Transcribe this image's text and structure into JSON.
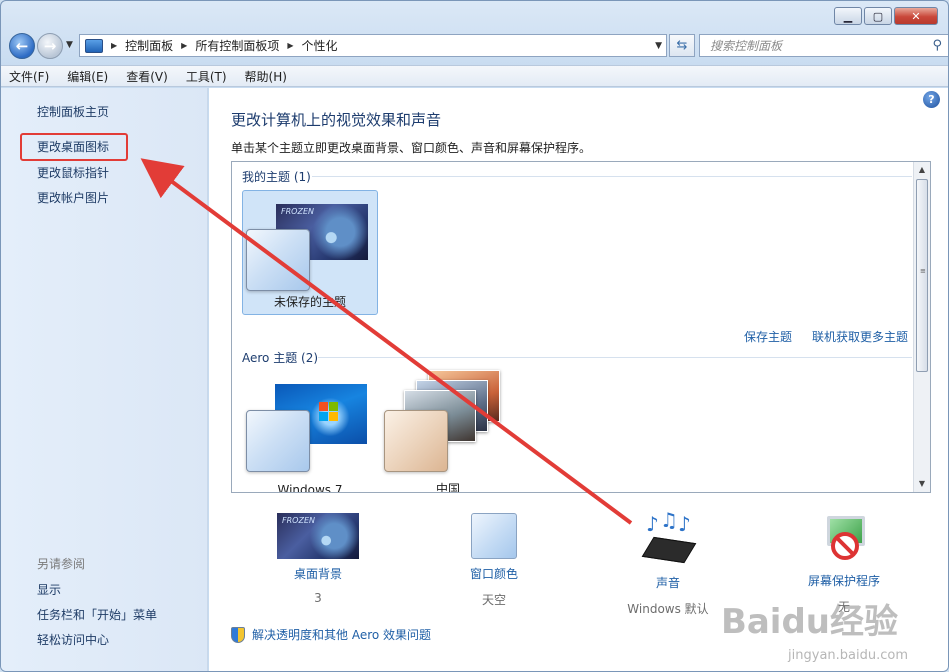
{
  "nav": {
    "breadcrumbs": [
      "控制面板",
      "所有控制面板项",
      "个性化"
    ],
    "search_placeholder": "搜索控制面板"
  },
  "menu": [
    "文件(F)",
    "编辑(E)",
    "查看(V)",
    "工具(T)",
    "帮助(H)"
  ],
  "sidebar": {
    "home": "控制面板主页",
    "links": [
      "更改桌面图标",
      "更改鼠标指针",
      "更改帐户图片"
    ],
    "see_also_title": "另请参阅",
    "see_also": [
      "显示",
      "任务栏和「开始」菜单",
      "轻松访问中心"
    ]
  },
  "main": {
    "title": "更改计算机上的视觉效果和声音",
    "subtitle": "单击某个主题立即更改桌面背景、窗口颜色、声音和屏幕保护程序。",
    "my_themes_header": "我的主题 (1)",
    "unsaved_theme": "未保存的主题",
    "save_theme": "保存主题",
    "get_more_themes": "联机获取更多主题",
    "aero_header": "Aero 主题 (2)",
    "aero_themes": [
      "Windows 7",
      "中国"
    ],
    "frozen_text": "FROZEN",
    "bottom": [
      {
        "label": "桌面背景",
        "value": "3"
      },
      {
        "label": "窗口颜色",
        "value": "天空"
      },
      {
        "label": "声音",
        "value": "Windows 默认"
      },
      {
        "label": "屏幕保护程序",
        "value": "无"
      }
    ],
    "fix_link": "解决透明度和其他 Aero 效果问题"
  },
  "colors": {
    "annotation_arrow": "#e23c37",
    "link": "#1f5fa6"
  },
  "watermark": {
    "text": "Baidu经验",
    "url": "jingyan.baidu.com"
  }
}
